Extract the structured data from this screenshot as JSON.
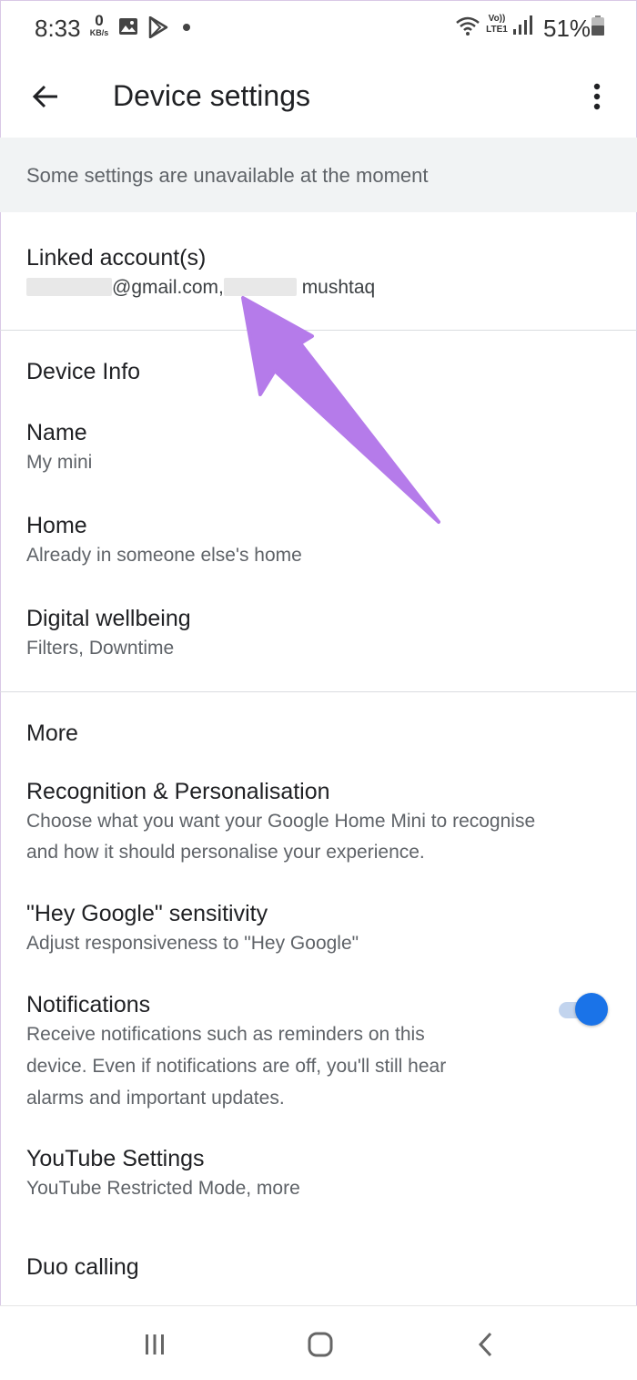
{
  "status_bar": {
    "time": "8:33",
    "net_speed_value": "0",
    "net_speed_unit": "KB/s",
    "volte_line1": "Vo))",
    "volte_line2": "LTE1",
    "battery": "51%"
  },
  "app_bar": {
    "title": "Device settings"
  },
  "banner": {
    "text": "Some settings are unavailable at the moment"
  },
  "linked_accounts": {
    "title": "Linked account(s)",
    "email_suffix": "@gmail.com,",
    "name_suffix": "mushtaq"
  },
  "device_info": {
    "section_title": "Device Info",
    "items": [
      {
        "title": "Name",
        "subtitle": "My mini"
      },
      {
        "title": "Home",
        "subtitle": "Already in someone else's home"
      },
      {
        "title": "Digital wellbeing",
        "subtitle": "Filters, Downtime"
      }
    ]
  },
  "more": {
    "section_title": "More",
    "recognition": {
      "title": "Recognition & Personalisation",
      "subtitle_line1": "Choose what you want your Google Home Mini to recognise",
      "subtitle_line2": "and how it should personalise your experience."
    },
    "hey_google": {
      "title": "\"Hey Google\" sensitivity",
      "subtitle": "Adjust responsiveness to \"Hey Google\""
    },
    "notifications": {
      "title": "Notifications",
      "subtitle_line1": "Receive notifications such as reminders on this",
      "subtitle_line2": "device. Even if notifications are off, you'll still hear",
      "subtitle_line3": "alarms and important updates.",
      "enabled": true
    },
    "youtube": {
      "title": "YouTube Settings",
      "subtitle": "YouTube Restricted Mode, more"
    },
    "duo": {
      "title": "Duo calling"
    }
  },
  "colors": {
    "accent": "#1a73e8",
    "arrow": "#b57bea",
    "banner_bg": "#f1f3f4"
  }
}
